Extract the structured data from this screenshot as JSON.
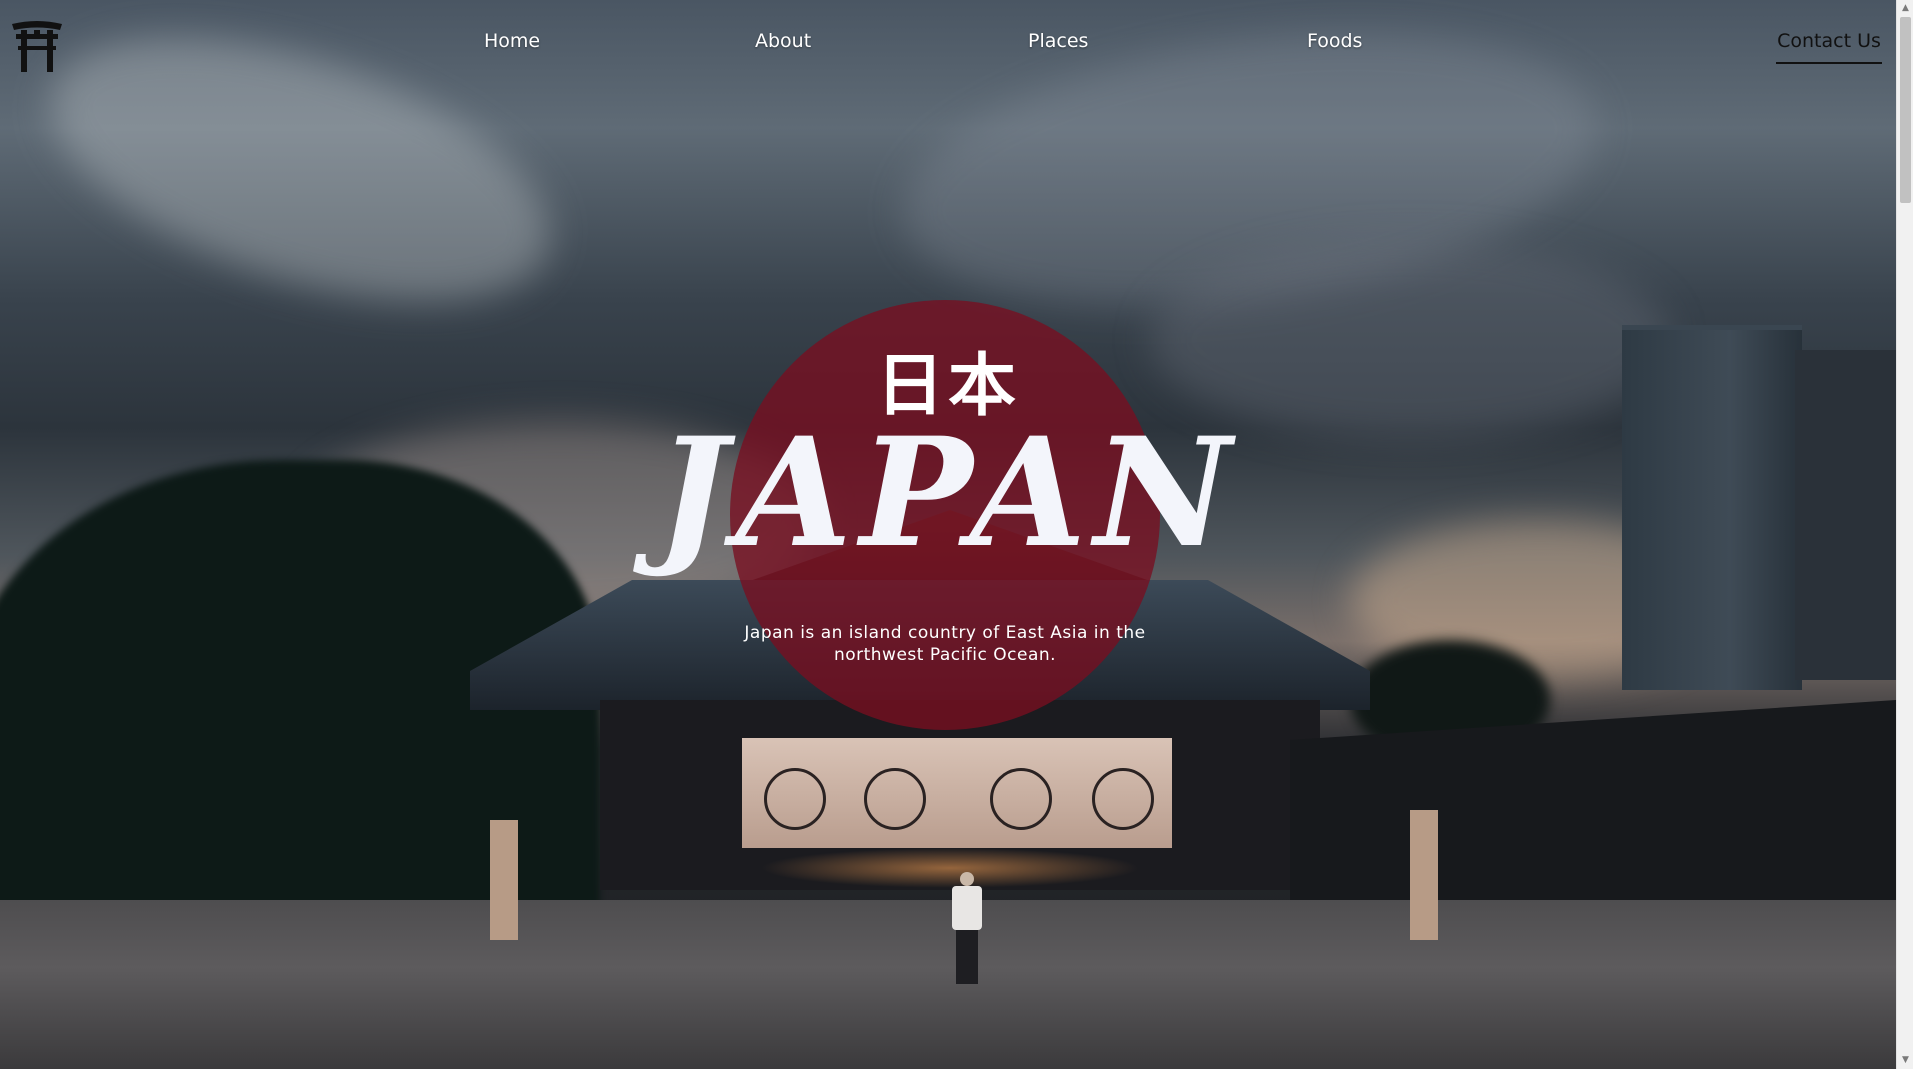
{
  "nav": {
    "logo_icon": "torii-gate-icon",
    "links": [
      {
        "label": "Home"
      },
      {
        "label": "About"
      },
      {
        "label": "Places"
      },
      {
        "label": "Foods"
      }
    ],
    "contact_label": "Contact Us"
  },
  "hero": {
    "kanji": "日本",
    "title": "JAPAN",
    "subtitle": "Japan is an island country of East Asia in the northwest Pacific Ocean.",
    "circle_color": "#7a0e20"
  },
  "colors": {
    "nav_text": "#ffffff",
    "contact_text": "#111111"
  }
}
